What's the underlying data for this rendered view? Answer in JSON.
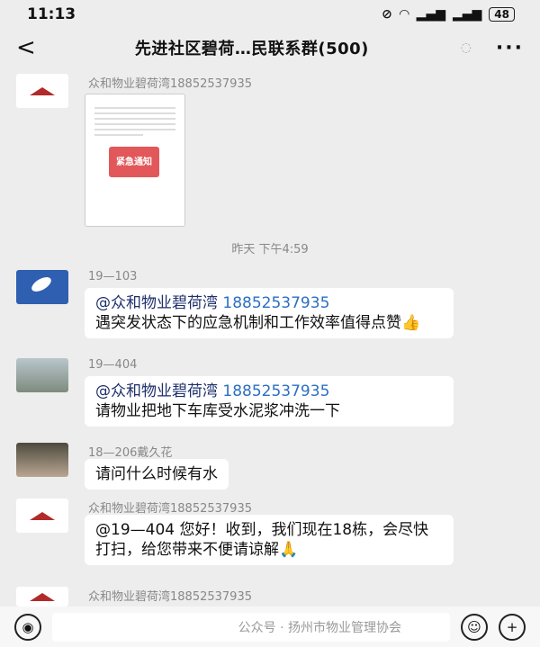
{
  "status": {
    "time": "11:13",
    "battery": "48"
  },
  "header": {
    "title": "先进社区碧荷…民联系群(500)",
    "back": "<",
    "more": "···",
    "mute": "◌"
  },
  "chat": {
    "msg1": {
      "sender": "众和物业碧荷湾18852537935",
      "shot_text": "紧急通知"
    },
    "timestamp": "昨天 下午4:59",
    "msg2": {
      "sender": "19—103",
      "at": "@众和物业碧荷湾",
      "phone": "18852537935",
      "text": "遇突发状态下的应急机制和工作效率值得点赞👍"
    },
    "msg3": {
      "sender": "19—404",
      "at": "@众和物业碧荷湾",
      "phone": "18852537935",
      "text": "请物业把地下车库受水泥浆冲洗一下"
    },
    "msg4": {
      "sender": "18—206戴久花",
      "text": "请问什么时候有水"
    },
    "msg5": {
      "sender": "众和物业碧荷湾18852537935",
      "text": "@19—404 您好！收到，我们现在18栋，会尽快打扫，给您带来不便请谅解🙏"
    },
    "msg6": {
      "sender": "众和物业碧荷湾18852537935"
    }
  },
  "input": {
    "watermark": "公众号 · 扬州市物业管理协会",
    "voice": "◉",
    "emoji": "☺",
    "plus": "+"
  }
}
